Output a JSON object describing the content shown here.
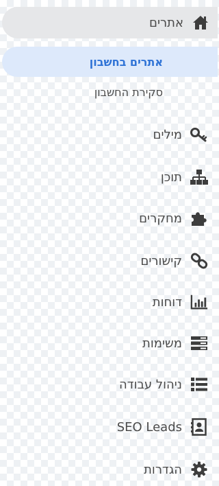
{
  "sidebar": {
    "header": {
      "label": "אתרים",
      "icon": "home-icon"
    },
    "subitems": [
      {
        "label": "אתרים בחשבון",
        "active": true
      },
      {
        "label": "סקירת החשבון",
        "active": false
      }
    ],
    "items": [
      {
        "label": "מילים",
        "icon": "key-icon"
      },
      {
        "label": "תוכן",
        "icon": "sitemap-icon"
      },
      {
        "label": "מחקרים",
        "icon": "puzzle-icon"
      },
      {
        "label": "קישורים",
        "icon": "link-icon"
      },
      {
        "label": "דוחות",
        "icon": "bar-chart-icon"
      },
      {
        "label": "משימות",
        "icon": "tasks-icon"
      },
      {
        "label": "ניהול עבודה",
        "icon": "list-icon"
      },
      {
        "label": "SEO Leads",
        "icon": "contact-card-icon"
      },
      {
        "label": "הגדרות",
        "icon": "gear-icon"
      }
    ]
  },
  "colors": {
    "text": "#4a4a4a",
    "icon": "#3d3d3d",
    "active_text": "#2f73d6",
    "active_bg": "#dde9fb",
    "header_bg": "#e6e7e9"
  }
}
